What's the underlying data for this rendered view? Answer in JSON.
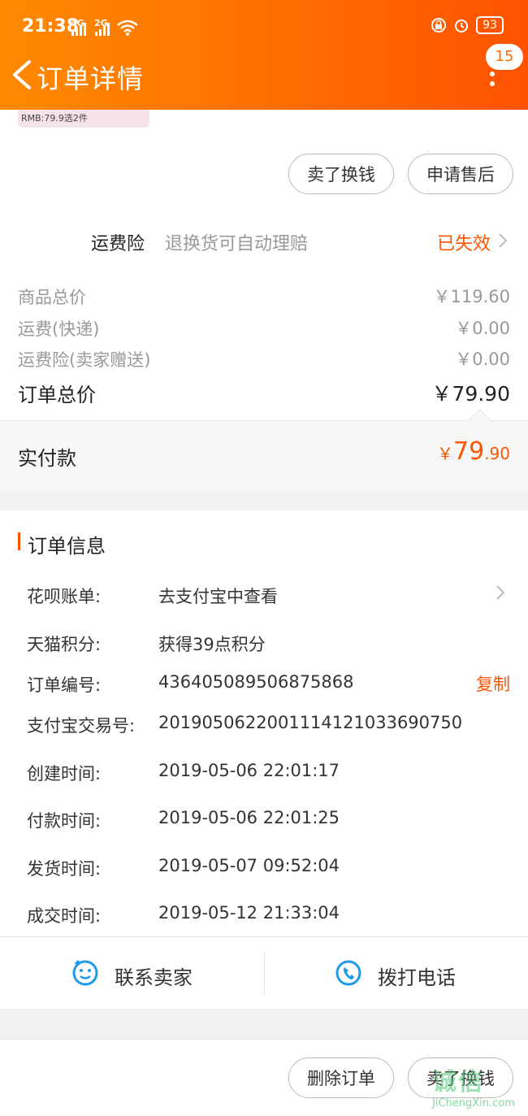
{
  "status_bar": {
    "time": "21:38",
    "signal_1": "4G",
    "signal_2": "2G",
    "battery": "93"
  },
  "header": {
    "title": "订单详情",
    "badge_count": "15"
  },
  "product_thumb": {
    "caption": "RMB:79.9选2件"
  },
  "actions_top": {
    "sell_label": "卖了换钱",
    "after_sale_label": "申请售后"
  },
  "insurance": {
    "label": "运费险",
    "desc": "退换货可自动理赔",
    "status": "已失效"
  },
  "price_rows": [
    {
      "label": "商品总价",
      "value": "￥119.60"
    },
    {
      "label": "运费(快递)",
      "value": "￥0.00"
    },
    {
      "label": "运费险(卖家赠送)",
      "value": "￥0.00"
    }
  ],
  "order_total": {
    "label": "订单总价",
    "value": "￥79.90"
  },
  "paid": {
    "label": "实付款",
    "symbol": "￥",
    "int": "79",
    "dec": ".90"
  },
  "order_info": {
    "title": "订单信息",
    "rows": [
      {
        "label": "花呗账单:",
        "value": "去支付宝中查看"
      },
      {
        "label": "天猫积分:",
        "value": "获得39点积分"
      },
      {
        "label": "订单编号:",
        "value": "436405089506875868"
      },
      {
        "label": "支付宝交易号:",
        "value": "2019050622001114121033690750"
      },
      {
        "label": "创建时间:",
        "value": "2019-05-06 22:01:17"
      },
      {
        "label": "付款时间:",
        "value": "2019-05-06 22:01:25"
      },
      {
        "label": "发货时间:",
        "value": "2019-05-07 09:52:04"
      },
      {
        "label": "成交时间:",
        "value": "2019-05-12 21:33:04"
      }
    ],
    "copy_label": "复制"
  },
  "contact": {
    "seller_label": "联系卖家",
    "phone_label": "拨打电话"
  },
  "actions_bottom": {
    "delete_label": "删除订单",
    "sell_label": "卖了换钱"
  },
  "watermark": {
    "main": "诚信",
    "sub": "JiChengXin.com"
  },
  "colors": {
    "accent": "#ff5500",
    "header_start": "#ff8a00",
    "header_end": "#ff5200",
    "icon_blue": "#1e9be8"
  }
}
